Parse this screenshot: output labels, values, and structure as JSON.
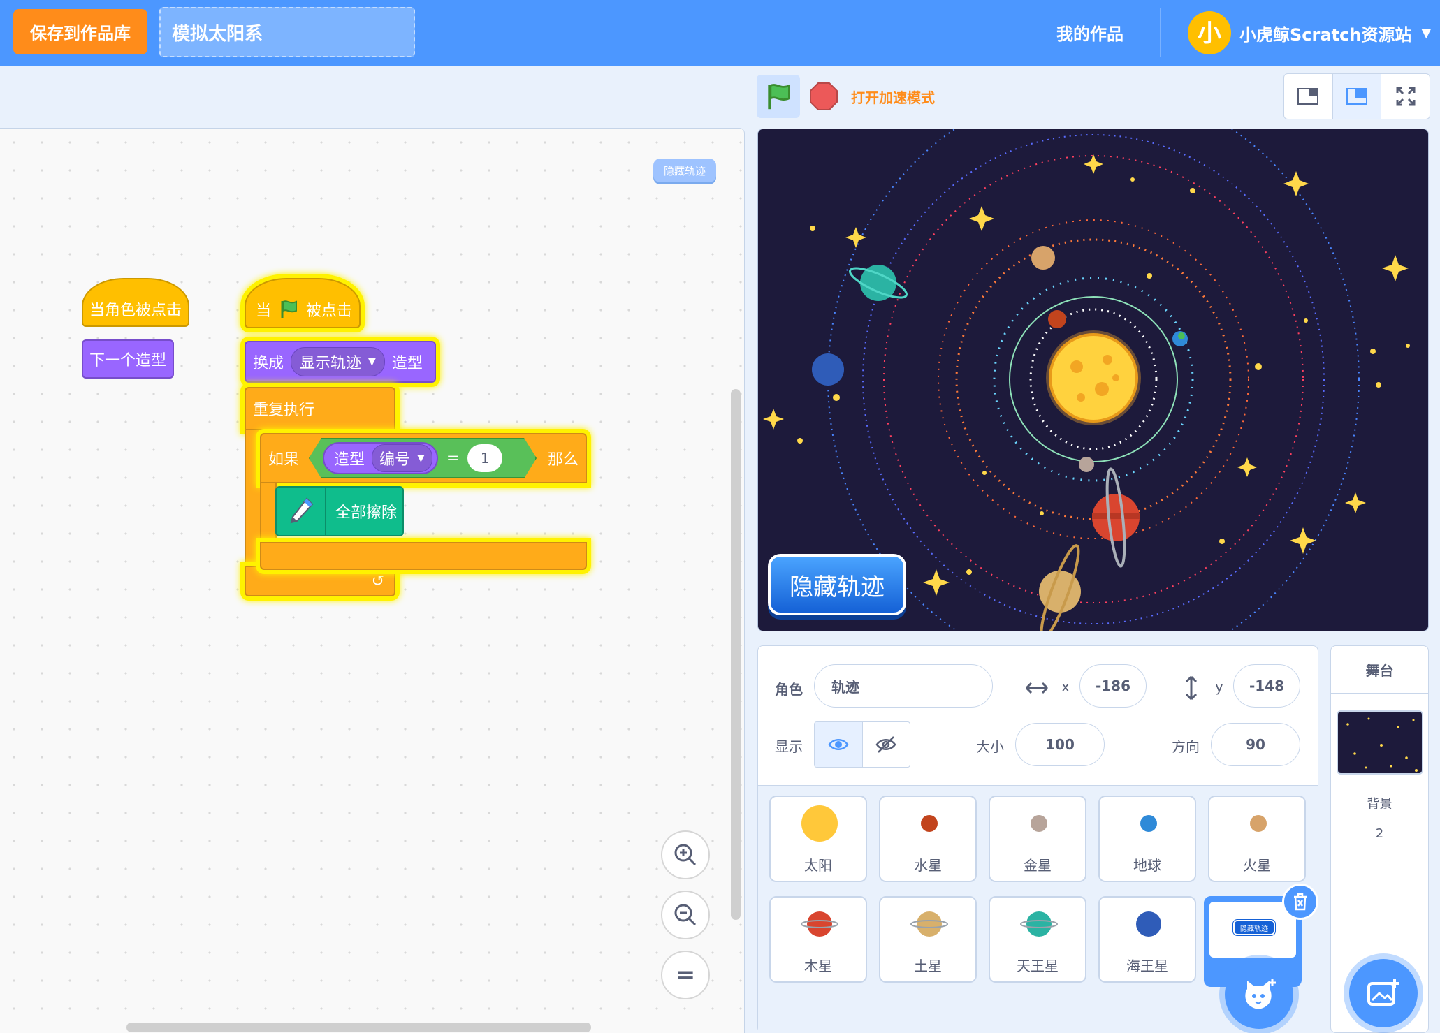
{
  "menubar": {
    "save_label": "保存到作品库",
    "project_title": "模拟太阳系",
    "my_works": "我的作品",
    "account_avatar_char": "小",
    "account_name": "小虎鲸Scratch资源站",
    "caret": "▼"
  },
  "workspace": {
    "hint_chip": "隐藏轨迹",
    "script1": {
      "hat": "当角色被点击",
      "next_costume": "下一个造型"
    },
    "script2": {
      "hat_when": "当",
      "hat_clicked": "被点击",
      "switch_prefix": "换成",
      "switch_menu": "显示轨迹",
      "switch_suffix": "造型",
      "forever": "重复执行",
      "if_label": "如果",
      "costume_reporter": "造型",
      "costume_field": "编号",
      "equals": "=",
      "compare_value": "1",
      "then_label": "那么",
      "pen_clear": "全部擦除",
      "dropdown_caret": "▼",
      "loop_arrow": "↺"
    },
    "zoom_reset": "="
  },
  "stage_header": {
    "turbo_label": "打开加速模式"
  },
  "stage": {
    "overlay_button": "隐藏轨迹"
  },
  "sprite_info": {
    "sprite_label": "角色",
    "sprite_name": "轨迹",
    "x_label": "x",
    "x_value": "-186",
    "y_label": "y",
    "y_value": "-148",
    "show_label": "显示",
    "size_label": "大小",
    "size_value": "100",
    "direction_label": "方向",
    "direction_value": "90"
  },
  "sprites": [
    {
      "name": "太阳",
      "color": "#ffc83a"
    },
    {
      "name": "水星",
      "color": "#c2441d"
    },
    {
      "name": "金星",
      "color": "#b7a49a"
    },
    {
      "name": "地球",
      "color": "#2f8ad8"
    },
    {
      "name": "火星",
      "color": "#d7a36a"
    },
    {
      "name": "木星",
      "color": "#d9452f"
    },
    {
      "name": "土星",
      "color": "#d8b06b"
    },
    {
      "name": "天王星",
      "color": "#2bb3a3"
    },
    {
      "name": "海王星",
      "color": "#2f5cb8"
    }
  ],
  "selected_sprite_thumb_text": "隐藏轨迹",
  "stage_pane": {
    "title": "舞台",
    "backdrop_label": "背景",
    "backdrop_count": "2"
  },
  "colors": {
    "accent": "#4c97ff",
    "save": "#ff8c1a",
    "events": "#ffbf00",
    "looks": "#9966ff",
    "control": "#ffab19",
    "operators": "#59c059",
    "pen": "#0fbd8c",
    "stage_bg": "#1d1a3b"
  }
}
